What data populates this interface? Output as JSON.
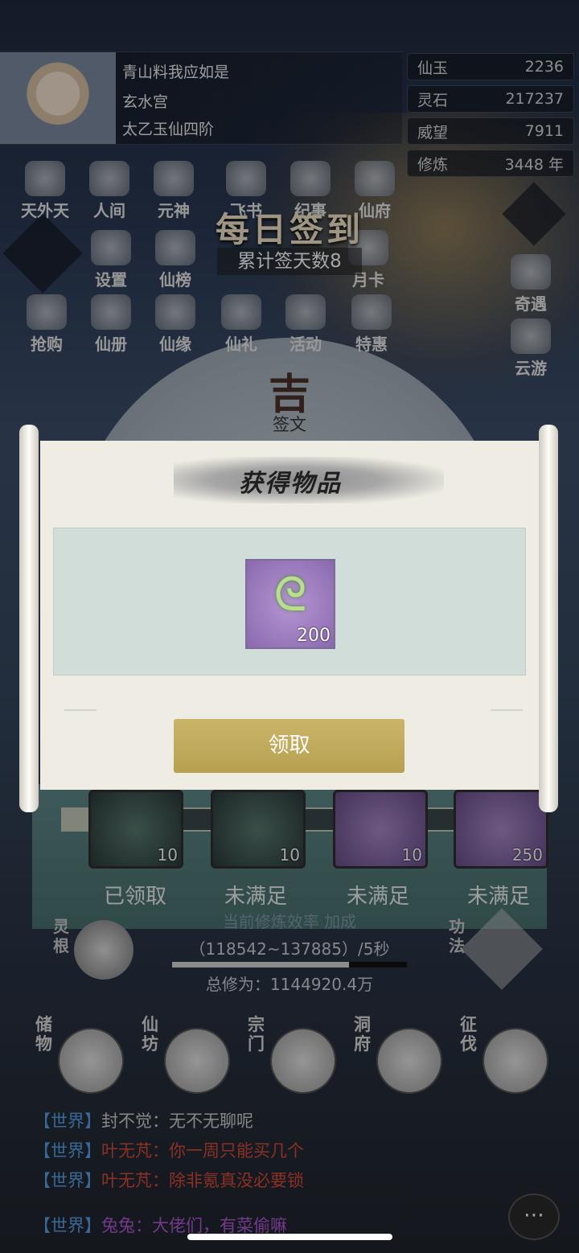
{
  "player": {
    "name": "青山料我应如是",
    "sect": "玄水宫",
    "realm": "太乙玉仙四阶"
  },
  "stats": [
    {
      "label": "仙玉",
      "value": "2236"
    },
    {
      "label": "灵石",
      "value": "217237"
    },
    {
      "label": "威望",
      "value": "7911"
    },
    {
      "label": "修炼",
      "value": "3448 年"
    }
  ],
  "icons_row1": [
    "天外天",
    "人间",
    "元神",
    "飞书",
    "纪事",
    "仙府"
  ],
  "icons_row2": [
    "设置",
    "仙榜",
    "月卡"
  ],
  "icons_row3": [
    "抢购",
    "仙册",
    "仙缘",
    "仙礼",
    "活动",
    "特惠"
  ],
  "side_icons": [
    "奇遇",
    "云游"
  ],
  "signin": {
    "title": "每日签到",
    "cumulative": "累计签天数8",
    "fortune": "吉",
    "fortune_label": "签文"
  },
  "rewards": [
    {
      "count": "10",
      "status": "已领取"
    },
    {
      "count": "10",
      "status": "未满足"
    },
    {
      "count": "10",
      "status": "未满足"
    },
    {
      "count": "250",
      "status": "未满足"
    }
  ],
  "cultivation": {
    "line1": "当前修炼效率  加成",
    "range": "（118542~137885）/5秒",
    "total": "总修为：1144920.4万",
    "side_left": "灵根",
    "side_right": "功法"
  },
  "bottom_buttons": [
    "储物",
    "仙坊",
    "宗门",
    "洞府",
    "征伐"
  ],
  "chat": [
    {
      "tag": "【世界】",
      "name": "封不觉",
      "sep": "：",
      "msg": "无不无聊呢"
    },
    {
      "tag": "【世界】",
      "name": "叶无芃",
      "sep": "：",
      "msg": "你一周只能买几个"
    },
    {
      "tag": "【世界】",
      "name": "叶无芃",
      "sep": "：",
      "msg": "除非氪真没必要锁"
    },
    {
      "tag": "【世界】",
      "name": "兔兔",
      "sep": "：",
      "msg": "大佬们，有菜偷嘛"
    }
  ],
  "dialog": {
    "title": "获得物品",
    "item_count": "200",
    "claim_label": "领取"
  },
  "colors": {
    "claim_gold": "#c9b46a",
    "chat_tag": "#5aa0e6",
    "chat_red": "#d84a3a",
    "chat_purple": "#b05ad6"
  }
}
